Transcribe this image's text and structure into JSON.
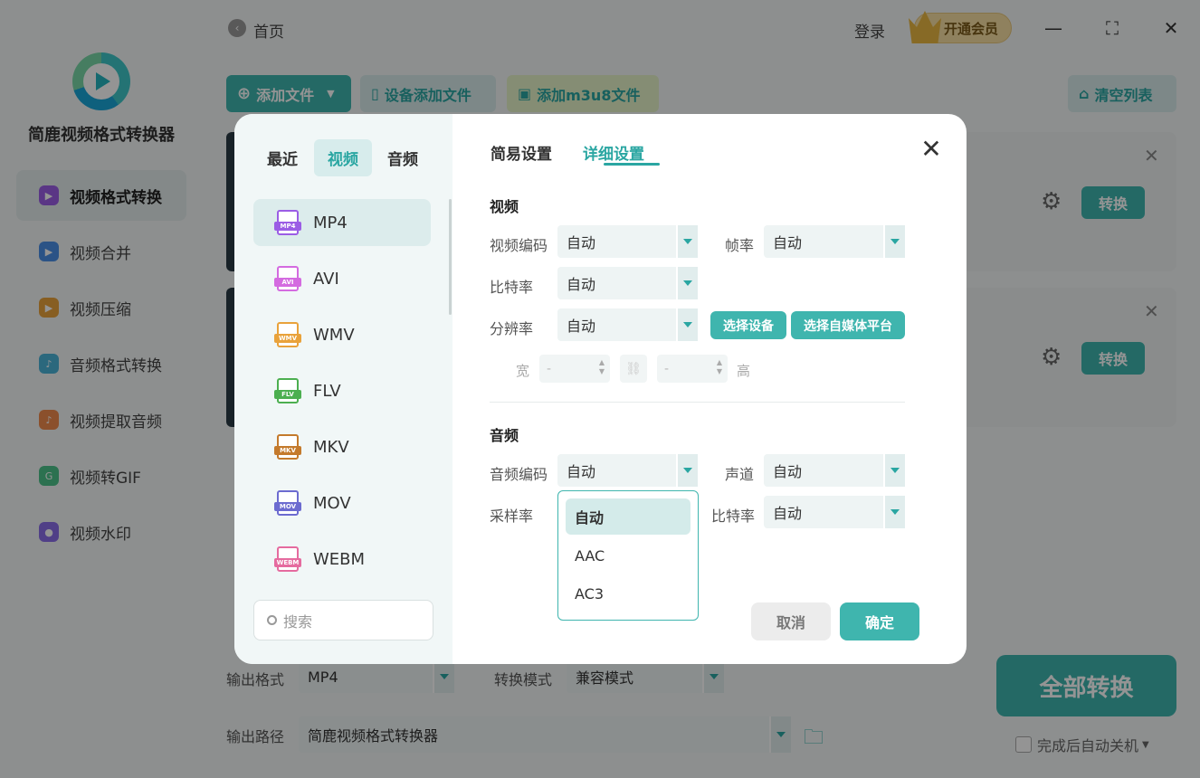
{
  "app": {
    "name": "简鹿视频格式转换器"
  },
  "sidebar": {
    "items": [
      {
        "label": "视频格式转换",
        "icon": "video-convert-icon",
        "color": "#9b5de5"
      },
      {
        "label": "视频合并",
        "icon": "video-merge-icon",
        "color": "#4a8fe7"
      },
      {
        "label": "视频压缩",
        "icon": "video-compress-icon",
        "color": "#e9a23b"
      },
      {
        "label": "音频格式转换",
        "icon": "audio-convert-icon",
        "color": "#4ab3d8"
      },
      {
        "label": "视频提取音频",
        "icon": "extract-audio-icon",
        "color": "#ef8a4c"
      },
      {
        "label": "视频转GIF",
        "icon": "gif-icon",
        "color": "#4cc38a"
      },
      {
        "label": "视频水印",
        "icon": "watermark-icon",
        "color": "#8a6de9"
      }
    ]
  },
  "header": {
    "home": "首页",
    "login": "登录",
    "vip": "开通会员"
  },
  "toolbar": {
    "add_file": "添加文件",
    "device_add": "设备添加文件",
    "add_m3u8": "添加m3u8文件",
    "clear": "清空列表"
  },
  "tasks": [
    {
      "action": "转换"
    },
    {
      "action": "转换"
    }
  ],
  "bottom": {
    "output_format_label": "输出格式",
    "output_format_value": "MP4",
    "mode_label": "转换模式",
    "mode_value": "兼容模式",
    "path_label": "输出路径",
    "path_value": "简鹿视频格式转换器",
    "convert_all": "全部转换",
    "auto_shutdown": "完成后自动关机"
  },
  "dialog": {
    "format_tabs": [
      "最近",
      "视频",
      "音频"
    ],
    "formats": [
      {
        "name": "MP4",
        "color": "#9b5de5"
      },
      {
        "name": "AVI",
        "color": "#d46be0"
      },
      {
        "name": "WMV",
        "color": "#e9a23b"
      },
      {
        "name": "FLV",
        "color": "#4caf50"
      },
      {
        "name": "MKV",
        "color": "#c47a2c"
      },
      {
        "name": "MOV",
        "color": "#6c6bd0"
      },
      {
        "name": "WEBM",
        "color": "#e56b9f"
      }
    ],
    "search_placeholder": "搜索",
    "settings_tabs": {
      "simple": "简易设置",
      "detailed": "详细设置"
    },
    "video": {
      "title": "视频",
      "codec_label": "视频编码",
      "codec_value": "自动",
      "fps_label": "帧率",
      "fps_value": "自动",
      "bitrate_label": "比特率",
      "bitrate_value": "自动",
      "resolution_label": "分辨率",
      "resolution_value": "自动",
      "select_device": "选择设备",
      "select_platform": "选择自媒体平台",
      "width_label": "宽",
      "height_label": "高",
      "width_value": "-",
      "height_value": "-"
    },
    "audio": {
      "title": "音频",
      "codec_label": "音频编码",
      "codec_value": "自动",
      "channel_label": "声道",
      "channel_value": "自动",
      "samplerate_label": "采样率",
      "bitrate_label": "比特率",
      "bitrate_value": "自动",
      "dropdown_options": [
        "自动",
        "AAC",
        "AC3"
      ]
    },
    "cancel": "取消",
    "confirm": "确定"
  }
}
